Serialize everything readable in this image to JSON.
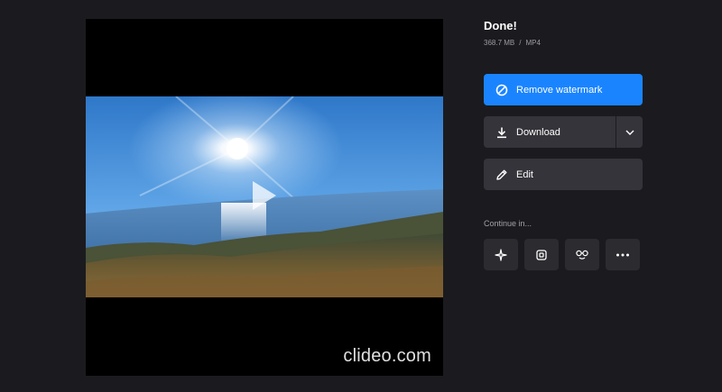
{
  "result": {
    "title": "Done!",
    "file_size": "368.7 MB",
    "separator": "/",
    "format": "MP4"
  },
  "player": {
    "watermark": "clideo.com",
    "play_icon": "play-icon"
  },
  "actions": {
    "remove_watermark": {
      "label": "Remove watermark",
      "icon": "no-sign-icon"
    },
    "download": {
      "label": "Download",
      "icon": "download-icon",
      "dropdown_icon": "chevron-down-icon"
    },
    "edit": {
      "label": "Edit",
      "icon": "pencil-icon"
    }
  },
  "continue": {
    "label": "Continue in...",
    "tools": [
      {
        "icon": "sparkle-icon"
      },
      {
        "icon": "crop-icon"
      },
      {
        "icon": "meme-glasses-icon"
      },
      {
        "icon": "more-icon"
      }
    ]
  },
  "colors": {
    "background": "#1b1b1f",
    "primary": "#1a84ff",
    "secondary_button": "#34343a",
    "tool_button": "#2b2b30"
  }
}
